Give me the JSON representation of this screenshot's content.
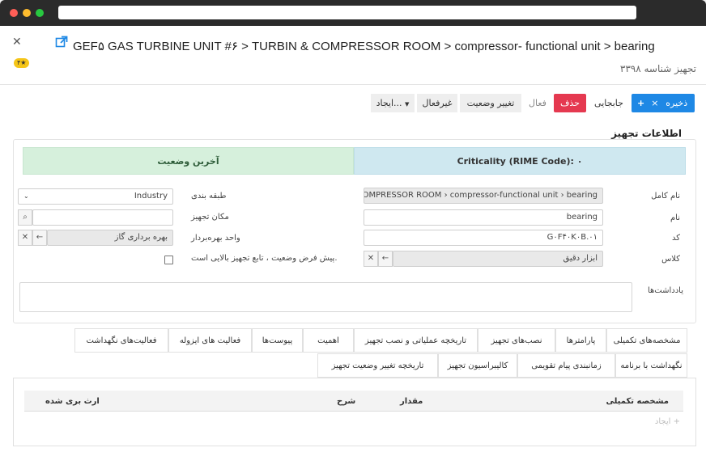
{
  "header": {
    "title": "GEF۵ GAS TURBINE UNIT #۶ > TURBIN & COMPRESSOR ROOM > compressor- functional unit > bearing",
    "subtitle": "تجهیز شناسه ۳۳۹۸",
    "badge": "۴★"
  },
  "toolbar": {
    "save": "ذخیره",
    "move": "جابجایی",
    "delete": "حذف",
    "active": "فعال",
    "change_status": "تغییر وضعیت",
    "inactive": "غیرفعال",
    "create": "ایجاد..."
  },
  "section": {
    "title": "اطلاعات تجهیز",
    "latest_status": "آخرین وضعیت",
    "criticality": "Criticality (RIME Code): ۰"
  },
  "form": {
    "full_name_label": "نام کامل",
    "full_name_value": "IN & COMPRESSOR ROOM › compressor-functional unit › bearing",
    "name_label": "نام",
    "name_value": "bearing",
    "code_label": "کد",
    "code_value": "G۰F۴۰K۰B.۰۱",
    "class_label": "کلاس",
    "class_value": "ابزار دقیق",
    "classification_label": "طبقه بندی",
    "classification_value": "Industry",
    "location_label": "مکان تجهیز",
    "location_value": "",
    "operator_unit_label": "واحد بهره‌بردار",
    "operator_unit_value": "بهره برداری گاز",
    "default_status_label": "پیش فرض وضعیت ، تابع تجهیز بالایی است.",
    "notes_label": "یادداشت‌ها"
  },
  "tabs_row1": [
    "مشخصه‌های تکمیلی",
    "پارامترها",
    "نصب‌های تجهیز",
    "تاریخچه عملیاتی و نصب تجهیز",
    "اهمیت",
    "پیوست‌ها",
    "فعالیت های ایزوله",
    "فعالیت‌های نگهداشت"
  ],
  "tabs_row2": [
    "نگهداشت با برنامه",
    "زمانبندی پیام تقویمی",
    "کالیبراسیون تجهیز",
    "تاریخچه تغییر وضعیت تجهیز"
  ],
  "table": {
    "col_feature": "مشخصه تکمیلی",
    "col_value": "مقدار",
    "col_desc": "شرح",
    "col_inherited": "ارث بری شده",
    "add": "ایجاد"
  },
  "colors": {
    "primary": "#1e88e5",
    "danger": "#e53950",
    "status_green": "#d6f0dc",
    "status_blue": "#cfe8f0"
  }
}
